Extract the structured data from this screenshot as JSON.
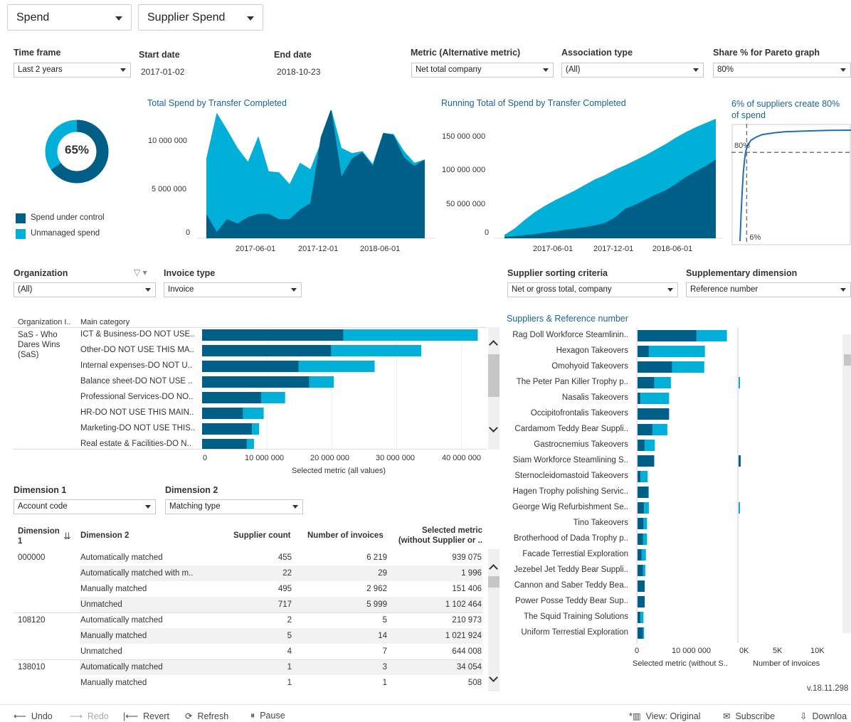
{
  "top": {
    "select1": "Spend",
    "select2": "Supplier Spend"
  },
  "filters": {
    "timeframe": {
      "label": "Time frame",
      "value": "Last 2 years"
    },
    "start": {
      "label": "Start date",
      "value": "2017-01-02"
    },
    "end": {
      "label": "End date",
      "value": "2018-10-23"
    },
    "metric": {
      "label": "Metric (Alternative metric)",
      "value": "Net total company"
    },
    "assoc": {
      "label": "Association type",
      "value": "(All)"
    },
    "share": {
      "label": "Share % for Pareto graph",
      "value": "80%"
    }
  },
  "donut": {
    "value_text": "65%",
    "fraction": 0.65,
    "colors": {
      "controlled": "#005f86",
      "unmanaged": "#00b0d8"
    }
  },
  "legend": {
    "controlled": "Spend under control",
    "unmanaged": "Unmanaged spend"
  },
  "chart_data": [
    {
      "type": "area",
      "title": "Total Spend by Transfer Completed",
      "ylim": [
        0,
        11500000
      ],
      "y_ticks": [
        "10 000 000",
        "5 000 000",
        "0"
      ],
      "x_ticks": [
        "2017-06-01",
        "2017-12-01",
        "2018-06-01"
      ],
      "series": [
        {
          "name": "Unmanaged spend",
          "values": [
            7500000,
            11800000,
            10200000,
            8500000,
            7200000,
            9600000,
            6300000,
            6200000,
            5100000,
            7100000,
            6500000,
            9000000,
            12200000,
            8500000,
            8000000,
            8200000,
            7000000,
            9900000,
            9800000,
            8200000,
            7100000,
            7400000
          ]
        },
        {
          "name": "Spend under control",
          "values": [
            2300000,
            600000,
            1800000,
            1400000,
            2000000,
            2300000,
            2300000,
            1800000,
            1800000,
            2700000,
            3300000,
            9500000,
            12200000,
            5800000,
            7500000,
            8100000,
            6800000,
            9900000,
            9700000,
            7600000,
            6800000,
            7400000
          ]
        }
      ]
    },
    {
      "type": "area",
      "title": "Running Total of Spend by Transfer Completed",
      "ylim": [
        0,
        170000000
      ],
      "y_ticks": [
        "150 000 000",
        "100 000 000",
        "50 000 000",
        "0"
      ],
      "x_ticks": [
        "2017-06-01",
        "2017-12-01",
        "2018-06-01"
      ],
      "series": [
        {
          "name": "Unmanaged spend",
          "values": [
            5000000,
            14000000,
            26000000,
            37000000,
            46000000,
            54000000,
            61000000,
            68000000,
            76000000,
            84000000,
            90000000,
            98000000,
            104000000,
            111000000,
            118000000,
            126000000,
            134000000,
            143000000,
            151000000,
            158000000,
            164000000,
            170000000
          ]
        },
        {
          "name": "Spend under control",
          "values": [
            2000000,
            3000000,
            4500000,
            6000000,
            8000000,
            10000000,
            12000000,
            14000000,
            16000000,
            18500000,
            22000000,
            30000000,
            42000000,
            48000000,
            55000000,
            62000000,
            68000000,
            77000000,
            87000000,
            95000000,
            103000000,
            112000000
          ]
        }
      ]
    },
    {
      "type": "line",
      "title": "6% of suppliers create 80% of spend",
      "ref_labels": [
        "80%",
        "6%"
      ],
      "x": [
        0,
        1,
        2,
        3,
        4,
        5,
        6,
        8,
        10,
        15,
        20,
        30,
        40,
        60,
        80,
        100
      ],
      "y": [
        0,
        25,
        45,
        62,
        72,
        80,
        84,
        88,
        91,
        94,
        96,
        97.5,
        98.5,
        99.3,
        99.8,
        100
      ]
    },
    {
      "type": "bar",
      "title": "Main category",
      "xlabel": "Selected metric (all values)",
      "x_ticks": [
        "0",
        "10 000 000",
        "20 000 000",
        "30 000 000",
        "40 000 000"
      ],
      "xlim": [
        0,
        43000000
      ],
      "categories": [
        "ICT & Business-DO NOT USE..",
        "Other-DO NOT USE THIS MA..",
        "Internal expenses-DO NOT U..",
        "Balance sheet-DO NOT USE ..",
        "Professional Services-DO NO..",
        "HR-DO NOT USE THIS MAIN..",
        "Marketing-DO NOT USE THIS..",
        "Real estate & Facilities-DO N.."
      ],
      "series": [
        {
          "name": "Spend under control",
          "values": [
            21800000,
            19900000,
            14900000,
            16500000,
            9100000,
            6300000,
            7700000,
            6900000
          ]
        },
        {
          "name": "Unmanaged spend",
          "values": [
            20700000,
            13900000,
            11700000,
            3800000,
            3700000,
            3200000,
            1100000,
            1100000
          ]
        }
      ]
    },
    {
      "type": "bar",
      "title": "Suppliers & Reference number",
      "xlabel": "Selected metric (without S..",
      "x_ticks": [
        "0",
        "10 000 000"
      ],
      "xlim": [
        0,
        16000000
      ],
      "categories": [
        "Rag Doll Workforce Steamlinin..",
        "Hexagon Takeovers",
        "Omohyoid Takeovers",
        "The Peter Pan Killer Trophy p..",
        "Nasalis Takeovers",
        "Occipitofrontalis Takeovers",
        "Cardamom Teddy Bear Suppli..",
        "Gastrocnemius Takeovers",
        "Siam Workforce Steamlining S..",
        "Sternocleidomastoid Takeovers",
        "Hagen Trophy polishing Servic..",
        "George Wig Refurbishment Se..",
        "Tino Takeovers",
        "Brotherhood of Dada Trophy p..",
        "Facade Terrestial Exploration",
        "Jezebel Jet Teddy Bear Suppli..",
        "Cannon and Saber Teddy Bea..",
        "Power Posse Teddy Bear Sup..",
        "The Squid Training Solutions",
        "Uniform Terrestial Exploration"
      ],
      "series": [
        {
          "name": "Spend under control",
          "values": [
            9900000,
            1900000,
            5800000,
            2800000,
            500000,
            5300000,
            2500000,
            1200000,
            2800000,
            500000,
            1800000,
            1100000,
            1000000,
            900000,
            700000,
            900000,
            1200000,
            1200000,
            500000,
            900000
          ]
        },
        {
          "name": "Unmanaged spend",
          "values": [
            5100000,
            9400000,
            5400000,
            2800000,
            4800000,
            0,
            2500000,
            1700000,
            0,
            1200000,
            100000,
            800000,
            600000,
            700000,
            700000,
            400000,
            0,
            0,
            500000,
            200000
          ]
        }
      ]
    },
    {
      "type": "bar",
      "title": "Number of invoices",
      "x_ticks": [
        "0K",
        "5K",
        "10K"
      ],
      "xlim": [
        0,
        12000
      ],
      "values": [
        0,
        0,
        0,
        150,
        0,
        0,
        0,
        0,
        250,
        0,
        0,
        120,
        0,
        0,
        0,
        0,
        0,
        0,
        0,
        0
      ]
    }
  ],
  "org": {
    "label": "Organization",
    "value": "(All)"
  },
  "invtype": {
    "label": "Invoice type",
    "value": "Invoice"
  },
  "supsort": {
    "label": "Supplier sorting criteria",
    "value": "Net or gross total, company"
  },
  "suppdim": {
    "label": "Supplementary dimension",
    "value": "Reference number"
  },
  "cat_table": {
    "col1": "Organization I..",
    "col2": "Main category",
    "org_name": "SaS - Who Dares Wins (SaS)"
  },
  "dim1": {
    "label": "Dimension 1",
    "value": "Account code"
  },
  "dim2": {
    "label": "Dimension 2",
    "value": "Matching type"
  },
  "table": {
    "headers": {
      "d1": "Dimension 1",
      "d2": "Dimension 2",
      "supplier": "Supplier count",
      "invoices": "Number of invoices",
      "metric_l1": "Selected metric",
      "metric_l2": "(without Supplier or .."
    },
    "rows": [
      {
        "d1": "000000",
        "d2": "Automatically matched",
        "s": "455",
        "n": "6 219",
        "m": "939 075"
      },
      {
        "d1": "",
        "d2": "Automatically matched with m..",
        "s": "22",
        "n": "29",
        "m": "1 996"
      },
      {
        "d1": "",
        "d2": "Manually matched",
        "s": "495",
        "n": "2 962",
        "m": "151 406"
      },
      {
        "d1": "",
        "d2": "Unmatched",
        "s": "717",
        "n": "5 999",
        "m": "1 102 464"
      },
      {
        "d1": "108120",
        "d2": "Automatically matched",
        "s": "2",
        "n": "5",
        "m": "210 973"
      },
      {
        "d1": "",
        "d2": "Manually matched",
        "s": "5",
        "n": "14",
        "m": "1 021 924"
      },
      {
        "d1": "",
        "d2": "Unmatched",
        "s": "4",
        "n": "7",
        "m": "644 008"
      },
      {
        "d1": "138010",
        "d2": "Automatically matched",
        "s": "1",
        "n": "3",
        "m": "34 054"
      },
      {
        "d1": "",
        "d2": "Manually matched",
        "s": "1",
        "n": "1",
        "m": "508"
      }
    ]
  },
  "version": "v.18.11.298",
  "toolbar": {
    "undo": "Undo",
    "redo": "Redo",
    "revert": "Revert",
    "refresh": "Refresh",
    "pause": "Pause",
    "view": "View: Original",
    "subscribe": "Subscribe",
    "download": "Downloa"
  }
}
